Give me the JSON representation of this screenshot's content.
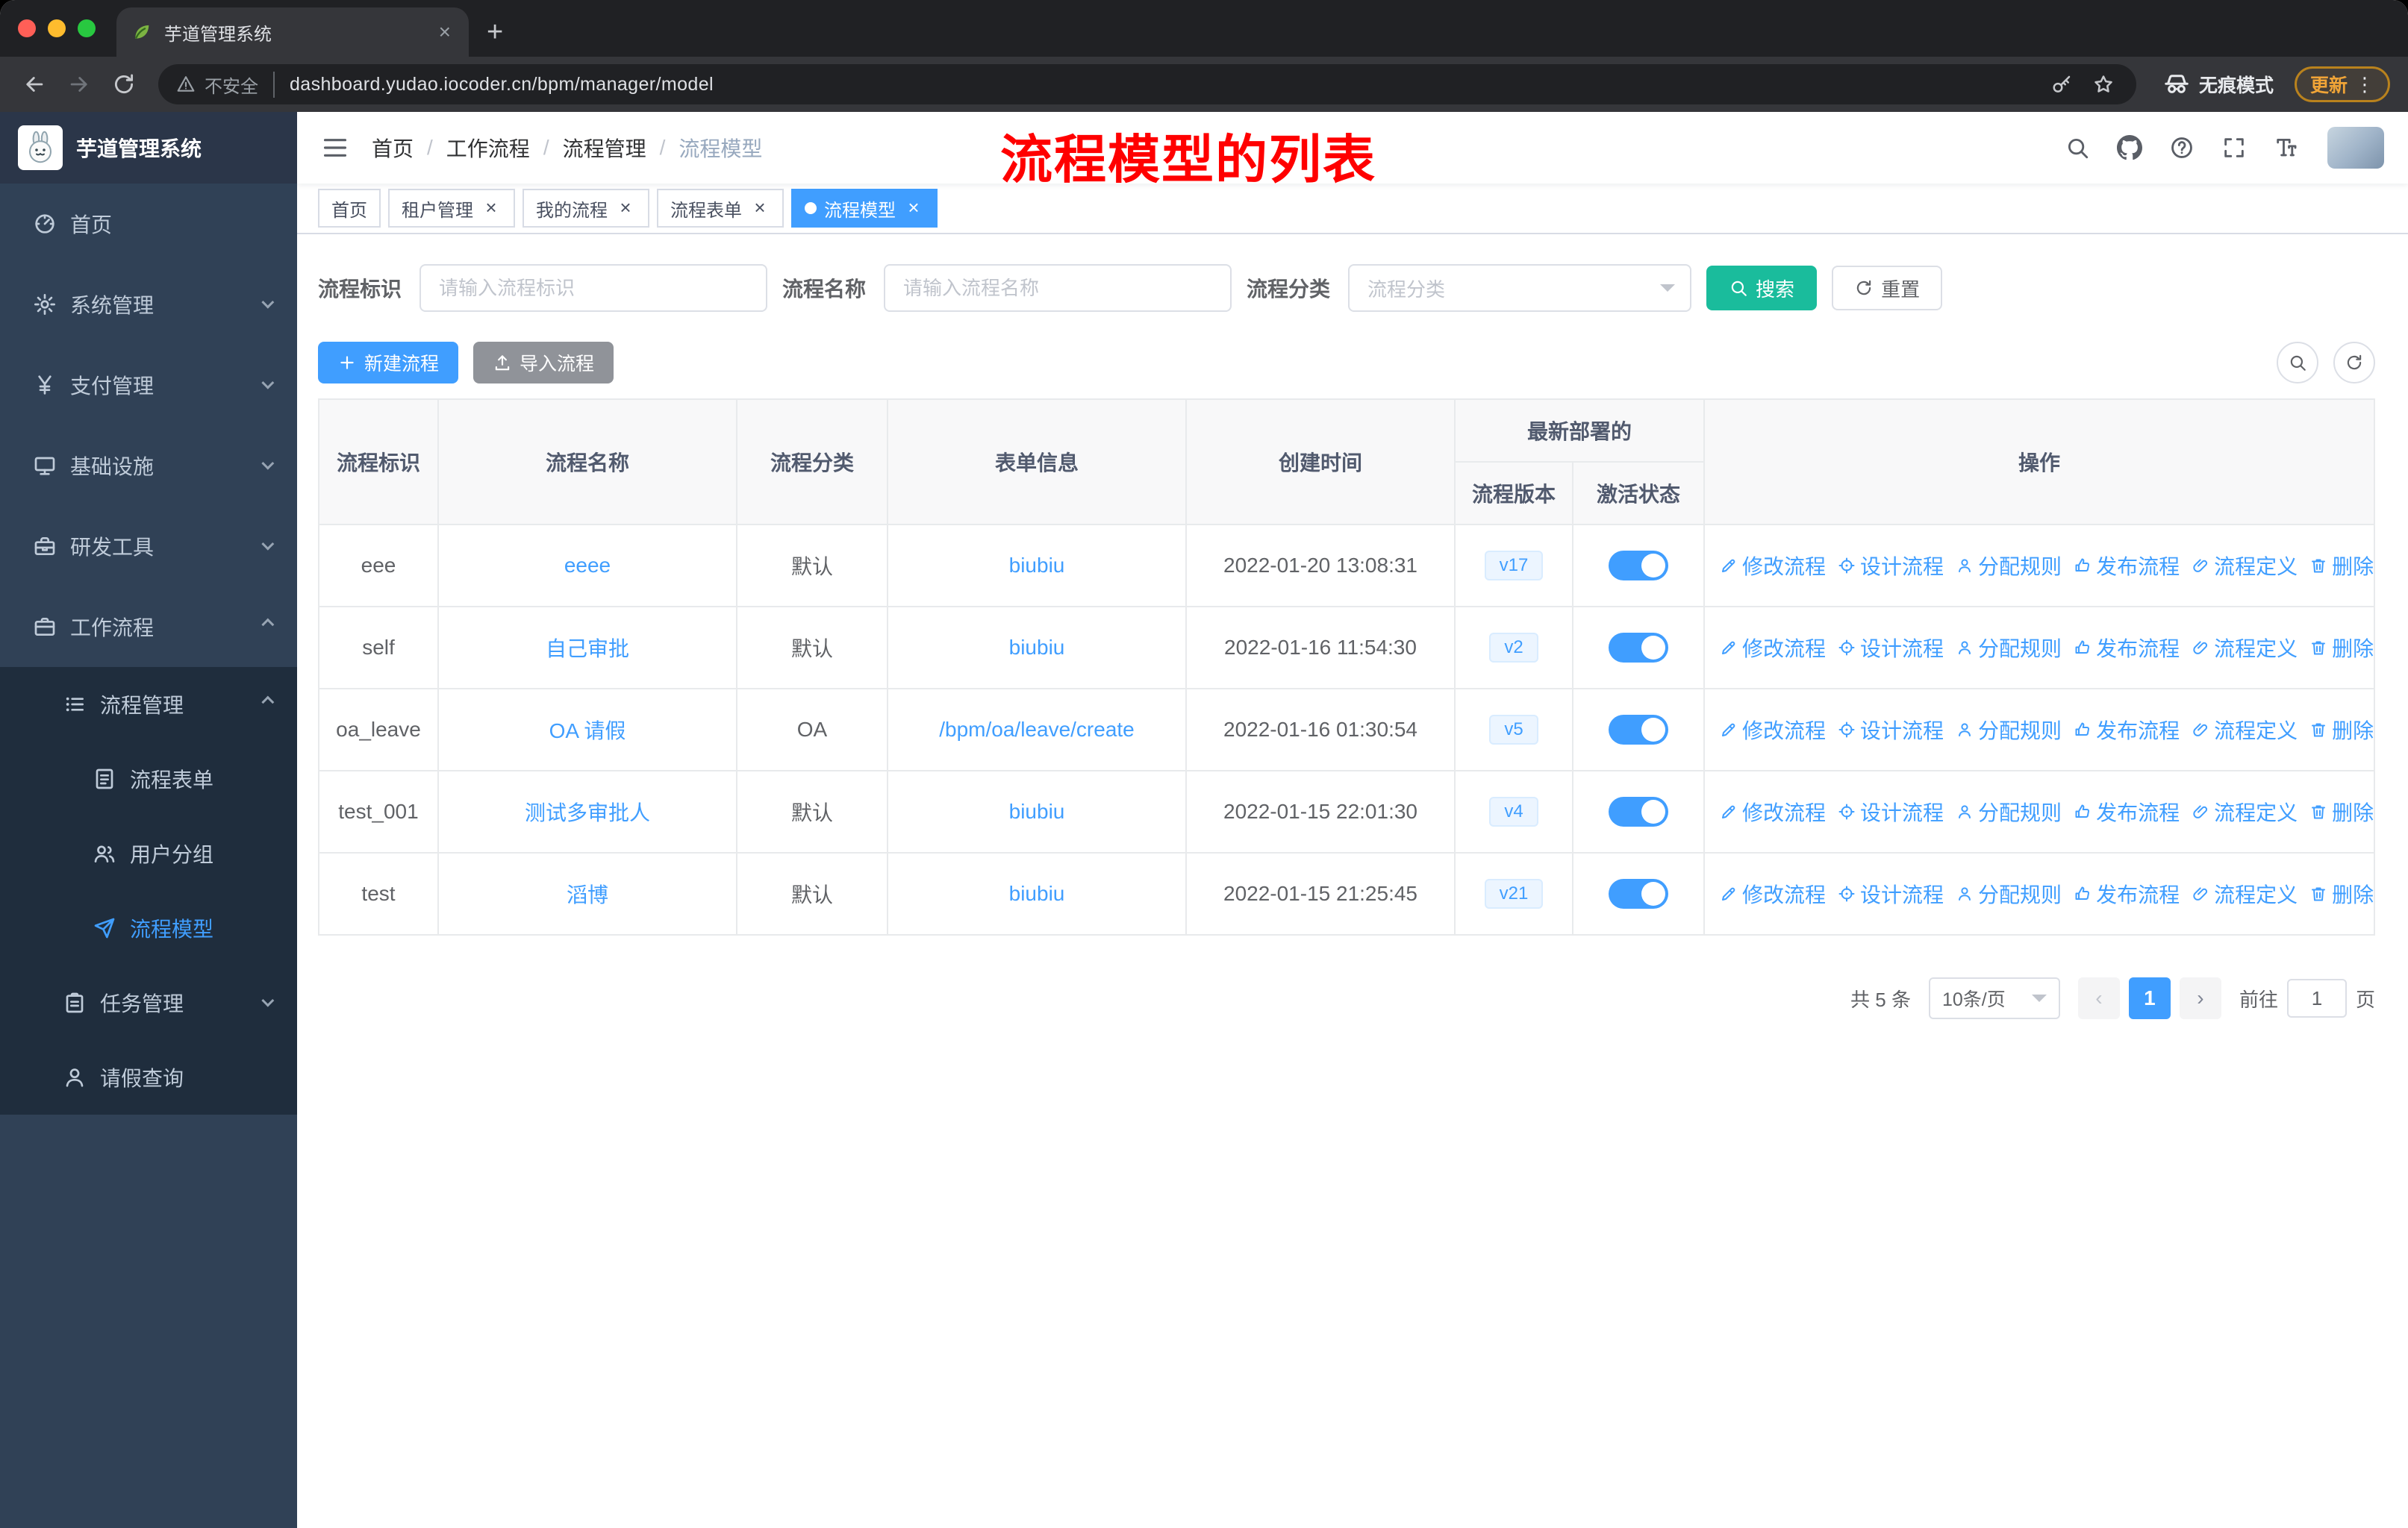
{
  "browser": {
    "tab_title": "芋道管理系统",
    "security_label": "不安全",
    "url": "dashboard.yudao.iocoder.cn/bpm/manager/model",
    "incognito_label": "无痕模式",
    "update_label": "更新"
  },
  "sidebar": {
    "app_title": "芋道管理系统",
    "menu": [
      {
        "id": "home",
        "label": "首页",
        "icon": "dashboard-icon",
        "level": 1
      },
      {
        "id": "system",
        "label": "系统管理",
        "icon": "gear-icon",
        "level": 1,
        "chevron": "down"
      },
      {
        "id": "payment",
        "label": "支付管理",
        "icon": "yen-icon",
        "level": 1,
        "chevron": "down"
      },
      {
        "id": "infra",
        "label": "基础设施",
        "icon": "monitor-icon",
        "level": 1,
        "chevron": "down"
      },
      {
        "id": "devtools",
        "label": "研发工具",
        "icon": "toolbox-icon",
        "level": 1,
        "chevron": "down"
      },
      {
        "id": "workflow",
        "label": "工作流程",
        "icon": "briefcase-icon",
        "level": 1,
        "chevron": "up"
      },
      {
        "id": "process-manage",
        "label": "流程管理",
        "icon": "tree-icon",
        "level": 2,
        "chevron": "up"
      },
      {
        "id": "process-form",
        "label": "流程表单",
        "icon": "form-icon",
        "level": 3
      },
      {
        "id": "user-group",
        "label": "用户分组",
        "icon": "users-icon",
        "level": 3
      },
      {
        "id": "process-model",
        "label": "流程模型",
        "icon": "send-icon",
        "level": 3,
        "active": true
      },
      {
        "id": "task-manage",
        "label": "任务管理",
        "icon": "clipboard-icon",
        "level": 2,
        "chevron": "down"
      },
      {
        "id": "leave-query",
        "label": "请假查询",
        "icon": "user-icon",
        "level": 2
      }
    ]
  },
  "navbar": {
    "breadcrumb": [
      "首页",
      "工作流程",
      "流程管理",
      "流程模型"
    ],
    "annotation": "流程模型的列表"
  },
  "tags": [
    {
      "id": "home",
      "label": "首页",
      "closable": false,
      "active": false
    },
    {
      "id": "tenant",
      "label": "租户管理",
      "closable": true,
      "active": false
    },
    {
      "id": "my-process",
      "label": "我的流程",
      "closable": true,
      "active": false
    },
    {
      "id": "process-form",
      "label": "流程表单",
      "closable": true,
      "active": false
    },
    {
      "id": "process-model",
      "label": "流程模型",
      "closable": true,
      "active": true
    }
  ],
  "filters": {
    "key_label": "流程标识",
    "key_placeholder": "请输入流程标识",
    "name_label": "流程名称",
    "name_placeholder": "请输入流程名称",
    "category_label": "流程分类",
    "category_placeholder": "流程分类",
    "search_label": "搜索",
    "reset_label": "重置"
  },
  "toolbar": {
    "create_label": "新建流程",
    "import_label": "导入流程"
  },
  "table": {
    "col_key": "流程标识",
    "col_name": "流程名称",
    "col_category": "流程分类",
    "col_form": "表单信息",
    "col_created": "创建时间",
    "col_deploy_group": "最新部署的",
    "col_version": "流程版本",
    "col_active": "激活状态",
    "col_actions": "操作",
    "actions": [
      {
        "id": "edit",
        "icon": "edit-icon",
        "label": "修改流程"
      },
      {
        "id": "design",
        "icon": "design-icon",
        "label": "设计流程"
      },
      {
        "id": "assign",
        "icon": "assign-icon",
        "label": "分配规则"
      },
      {
        "id": "publish",
        "icon": "publish-icon",
        "label": "发布流程"
      },
      {
        "id": "definition",
        "icon": "definition-icon",
        "label": "流程定义"
      },
      {
        "id": "delete",
        "icon": "delete-icon",
        "label": "删除"
      }
    ],
    "rows": [
      {
        "key": "eee",
        "name": "eeee",
        "category": "默认",
        "form": "biubiu",
        "created": "2022-01-20 13:08:31",
        "version": "v17",
        "active": true
      },
      {
        "key": "self",
        "name": "自己审批",
        "category": "默认",
        "form": "biubiu",
        "created": "2022-01-16 11:54:30",
        "version": "v2",
        "active": true
      },
      {
        "key": "oa_leave",
        "name": "OA 请假",
        "category": "OA",
        "form": "/bpm/oa/leave/create",
        "created": "2022-01-16 01:30:54",
        "version": "v5",
        "active": true
      },
      {
        "key": "test_001",
        "name": "测试多审批人",
        "category": "默认",
        "form": "biubiu",
        "created": "2022-01-15 22:01:30",
        "version": "v4",
        "active": true
      },
      {
        "key": "test",
        "name": "滔博",
        "category": "默认",
        "form": "biubiu",
        "created": "2022-01-15 21:25:45",
        "version": "v21",
        "active": true
      }
    ]
  },
  "pagination": {
    "total": "共 5 条",
    "page_size": "10条/页",
    "page": "1",
    "goto_label": "前往",
    "goto_value": "1",
    "unit_label": "页"
  },
  "colors": {
    "primary": "#409eff",
    "search_button": "#1abc9c",
    "annotation": "#ff0000",
    "sidebar": "#304156"
  }
}
